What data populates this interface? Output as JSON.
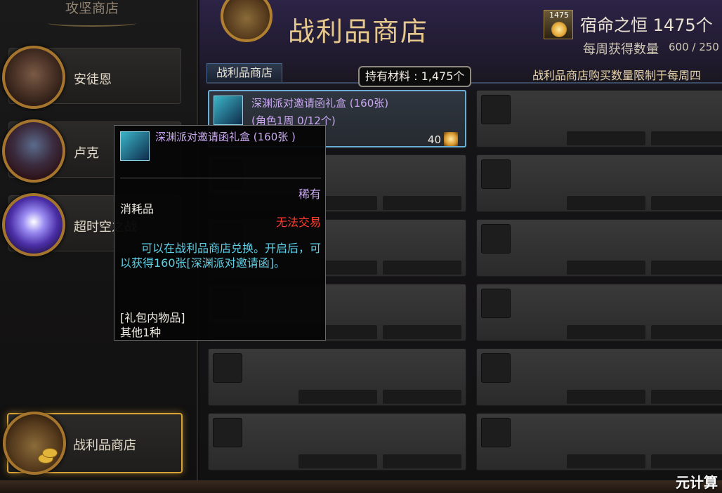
{
  "left_panel": {
    "title": "攻坚商店",
    "categories": [
      {
        "label": "安徒恩"
      },
      {
        "label": "卢克"
      },
      {
        "label": "超时空之战"
      }
    ],
    "active_category": {
      "label": "战利品商店"
    }
  },
  "header": {
    "title": "战利品商店",
    "currency": {
      "icon_badge": "1475",
      "label": "宿命之恒 1475个",
      "weekly_label": "每周获得数量",
      "weekly_value": "600 / 250"
    }
  },
  "tabs": [
    {
      "label": "战利品商店"
    }
  ],
  "held_materials": "持有材料 : 1,475个",
  "limit_notice": "战利品商店购买数量限制于每周四",
  "items": [
    {
      "name": "深渊派对邀请函礼盒 (160张)",
      "sub": "(角色1周 0/12个)",
      "price": "40"
    }
  ],
  "tooltip": {
    "name": "深渊派对邀请函礼盒 (160张 )",
    "rarity": "稀有",
    "type": "消耗品",
    "trade": "无法交易",
    "description": "可以在战利品商店兑换。开启后，可以获得160张[深渊派对邀请函]。",
    "contents_title": "[礼包内物品]",
    "contents_value": "其他1种"
  },
  "watermark": "元计算",
  "colors": {
    "rare_purple": "#c9a8f0",
    "untradeable_red": "#ff3b2e",
    "desc_cyan": "#5fd1e8",
    "active_gold": "#d8a235",
    "selected_blue": "#6aaed8"
  }
}
